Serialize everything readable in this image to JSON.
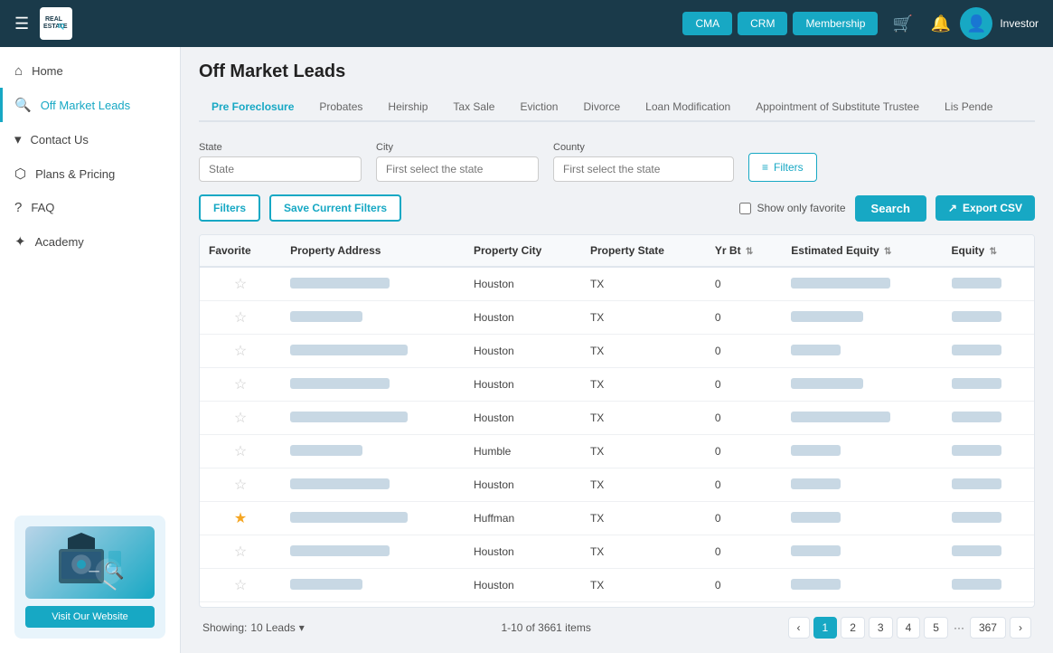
{
  "topNav": {
    "hamburger": "☰",
    "logo_text": "ESTATEBQ",
    "cma_label": "CMA",
    "crm_label": "CRM",
    "membership_label": "Membership",
    "investor_label": "Investor"
  },
  "sidebar": {
    "items": [
      {
        "id": "home",
        "icon": "⌂",
        "label": "Home",
        "active": false
      },
      {
        "id": "off-market-leads",
        "icon": "🔍",
        "label": "Off Market Leads",
        "active": true
      },
      {
        "id": "contact-us",
        "icon": "▾",
        "label": "Contact Us",
        "active": false
      },
      {
        "id": "plans-pricing",
        "icon": "♦",
        "label": "Plans & Pricing",
        "active": false
      },
      {
        "id": "faq",
        "icon": "?",
        "label": "FAQ",
        "active": false
      },
      {
        "id": "academy",
        "icon": "♣",
        "label": "Academy",
        "active": false
      }
    ],
    "promo": {
      "button_label": "Visit Our Website"
    }
  },
  "page": {
    "title": "Off Market Leads",
    "tabs": [
      {
        "id": "pre-foreclosure",
        "label": "Pre Foreclosure",
        "active": true
      },
      {
        "id": "probates",
        "label": "Probates",
        "active": false
      },
      {
        "id": "heirship",
        "label": "Heirship",
        "active": false
      },
      {
        "id": "tax-sale",
        "label": "Tax Sale",
        "active": false
      },
      {
        "id": "eviction",
        "label": "Eviction",
        "active": false
      },
      {
        "id": "divorce",
        "label": "Divorce",
        "active": false
      },
      {
        "id": "loan-modification",
        "label": "Loan Modification",
        "active": false
      },
      {
        "id": "appointment-substitute-trustee",
        "label": "Appointment of Substitute Trustee",
        "active": false
      },
      {
        "id": "lis-pende",
        "label": "Lis Pende",
        "active": false
      }
    ]
  },
  "filters": {
    "state_label": "State",
    "state_placeholder": "State",
    "city_label": "City",
    "city_placeholder": "First select the state",
    "county_label": "County",
    "county_placeholder": "First select the state",
    "filters_btn": "Filters"
  },
  "actions": {
    "filters_btn": "Filters",
    "save_filters_btn": "Save Current Filters",
    "show_favorite_label": "Show only favorite",
    "search_btn": "Search",
    "export_btn": "Export CSV"
  },
  "table": {
    "columns": [
      {
        "id": "favorite",
        "label": "Favorite"
      },
      {
        "id": "property-address",
        "label": "Property Address"
      },
      {
        "id": "property-city",
        "label": "Property City"
      },
      {
        "id": "property-state",
        "label": "Property State"
      },
      {
        "id": "yr-bt",
        "label": "Yr Bt",
        "sortable": true
      },
      {
        "id": "estimated-equity",
        "label": "Estimated Equity",
        "sortable": true
      },
      {
        "id": "equity",
        "label": "Equity",
        "sortable": true
      }
    ],
    "rows": [
      {
        "favorite": false,
        "address_blurred": true,
        "city": "Houston",
        "state": "TX",
        "yr_bt": "0",
        "equity_est_blurred": true,
        "equity_blurred": true
      },
      {
        "favorite": false,
        "address_blurred": true,
        "city": "Houston",
        "state": "TX",
        "yr_bt": "0",
        "equity_est_blurred": true,
        "equity_blurred": true
      },
      {
        "favorite": false,
        "address_blurred": true,
        "city": "Houston",
        "state": "TX",
        "yr_bt": "0",
        "equity_est_blurred": true,
        "equity_blurred": true
      },
      {
        "favorite": false,
        "address_blurred": true,
        "city": "Houston",
        "state": "TX",
        "yr_bt": "0",
        "equity_est_blurred": true,
        "equity_blurred": true
      },
      {
        "favorite": false,
        "address_blurred": true,
        "city": "Houston",
        "state": "TX",
        "yr_bt": "0",
        "equity_est_blurred": true,
        "equity_blurred": true
      },
      {
        "favorite": false,
        "address_blurred": true,
        "city": "Humble",
        "state": "TX",
        "yr_bt": "0",
        "equity_est_blurred": true,
        "equity_blurred": true
      },
      {
        "favorite": false,
        "address_blurred": true,
        "city": "Houston",
        "state": "TX",
        "yr_bt": "0",
        "equity_est_blurred": true,
        "equity_blurred": true
      },
      {
        "favorite": true,
        "address_blurred": true,
        "city": "Huffman",
        "state": "TX",
        "yr_bt": "0",
        "equity_est_blurred": true,
        "equity_blurred": true
      },
      {
        "favorite": false,
        "address_blurred": true,
        "city": "Houston",
        "state": "TX",
        "yr_bt": "0",
        "equity_est_blurred": true,
        "equity_blurred": true
      },
      {
        "favorite": false,
        "address_blurred": true,
        "city": "Houston",
        "state": "TX",
        "yr_bt": "0",
        "equity_est_blurred": true,
        "equity_blurred": true
      }
    ]
  },
  "pagination": {
    "showing_label": "Showing:",
    "per_page": "10 Leads",
    "range_text": "1-10 of 3661 items",
    "pages": [
      "1",
      "2",
      "3",
      "4",
      "5",
      "...",
      "367"
    ],
    "current_page": "1",
    "prev_icon": "‹",
    "next_icon": "›"
  }
}
